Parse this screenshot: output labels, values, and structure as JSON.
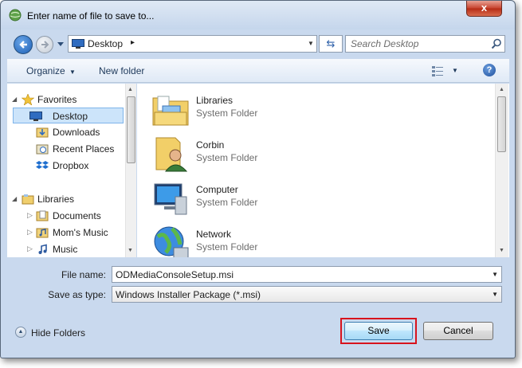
{
  "window": {
    "title": "Enter name of file to save to...",
    "close_glyph": "x"
  },
  "address_bar": {
    "location": "Desktop",
    "separator": "▸",
    "dropdown_glyph": "▼",
    "refresh_glyph": "⇆"
  },
  "search": {
    "placeholder": "Search Desktop"
  },
  "toolbar": {
    "organize_label": "Organize",
    "organize_caret": "▼",
    "new_folder_label": "New folder",
    "view_caret": "▼",
    "help_glyph": "?"
  },
  "navigation": {
    "favorites_label": "Favorites",
    "favorites": [
      {
        "label": "Desktop",
        "icon": "desktop-icon",
        "selected": true
      },
      {
        "label": "Downloads",
        "icon": "downloads-icon"
      },
      {
        "label": "Recent Places",
        "icon": "recent-places-icon"
      },
      {
        "label": "Dropbox",
        "icon": "dropbox-icon"
      }
    ],
    "libraries_label": "Libraries",
    "libraries": [
      {
        "label": "Documents",
        "icon": "documents-icon"
      },
      {
        "label": "Mom's Music",
        "icon": "music-icon"
      },
      {
        "label": "Music",
        "icon": "music-icon"
      }
    ],
    "expand_glyph": "▷",
    "collapse_glyph": "◢"
  },
  "files": [
    {
      "name": "Libraries",
      "type": "System Folder",
      "icon": "libraries-folder-icon"
    },
    {
      "name": "Corbin",
      "type": "System Folder",
      "icon": "user-folder-icon"
    },
    {
      "name": "Computer",
      "type": "System Folder",
      "icon": "computer-icon"
    },
    {
      "name": "Network",
      "type": "System Folder",
      "icon": "network-icon"
    }
  ],
  "save_form": {
    "file_name_label": "File name:",
    "file_name_value": "ODMediaConsoleSetup.msi",
    "save_type_label": "Save as type:",
    "save_type_value": "Windows Installer Package (*.msi)",
    "combo_caret": "▼"
  },
  "footer": {
    "hide_folders_label": "Hide Folders",
    "hide_glyph": "▲",
    "save_label": "Save",
    "cancel_label": "Cancel"
  },
  "colors": {
    "frame": "#c9d9ee",
    "selection": "#cce4fa",
    "highlight_box": "#d8131d",
    "close_button": "#c7422d"
  }
}
